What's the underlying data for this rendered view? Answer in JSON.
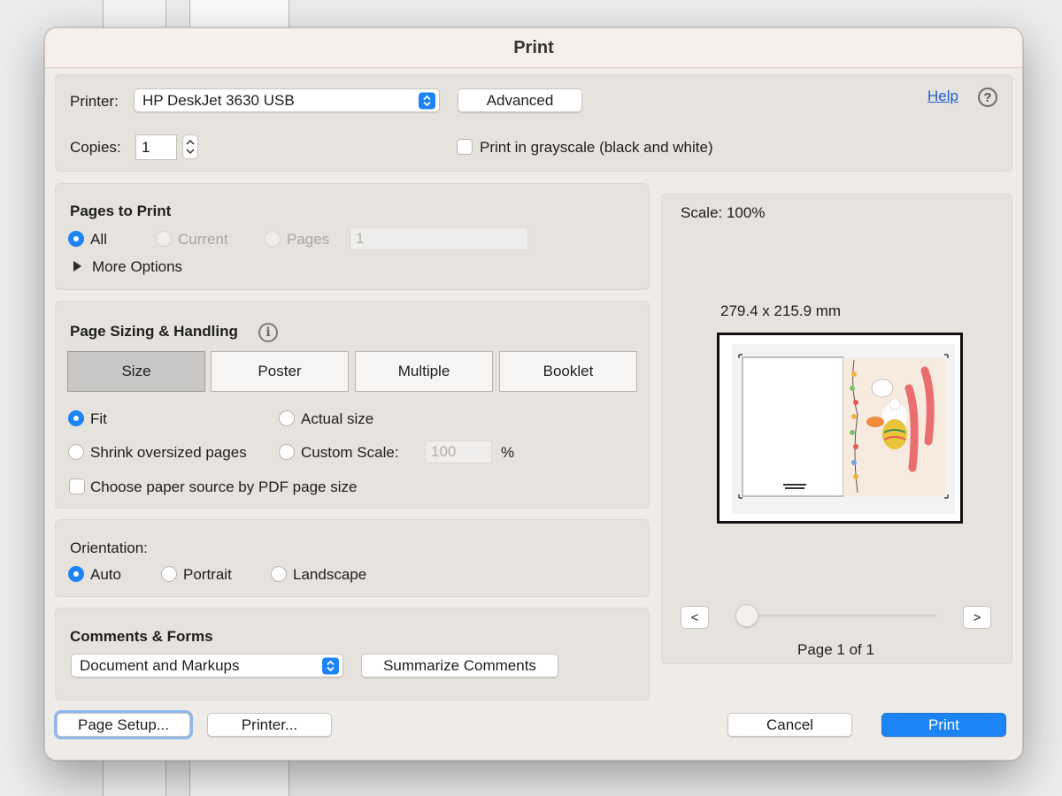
{
  "dialog": {
    "title": "Print"
  },
  "printer": {
    "label": "Printer:",
    "selected": "HP DeskJet 3630 USB",
    "advanced_label": "Advanced",
    "help_label": "Help",
    "help_icon": "question-circle-icon"
  },
  "copies": {
    "label": "Copies:",
    "value": "1"
  },
  "grayscale": {
    "label": "Print in grayscale (black and white)",
    "checked": false
  },
  "pages_to_print": {
    "title": "Pages to Print",
    "options": [
      "All",
      "Current",
      "Pages"
    ],
    "selected": "All",
    "pages_value": "1",
    "more_options_label": "More Options"
  },
  "sizing": {
    "title": "Page Sizing & Handling",
    "tabs": [
      "Size",
      "Poster",
      "Multiple",
      "Booklet"
    ],
    "active_tab": "Size",
    "fit_label": "Fit",
    "actual_size_label": "Actual size",
    "shrink_label": "Shrink oversized pages",
    "custom_scale_label": "Custom Scale:",
    "custom_scale_value": "100",
    "percent_sign": "%",
    "selected": "Fit",
    "paper_source_label": "Choose paper source by PDF page size"
  },
  "orientation": {
    "label": "Orientation:",
    "options": [
      "Auto",
      "Portrait",
      "Landscape"
    ],
    "selected": "Auto"
  },
  "comments_forms": {
    "title": "Comments & Forms",
    "selected": "Document and Markups",
    "summarize_label": "Summarize Comments"
  },
  "preview": {
    "scale_label": "Scale: 100%",
    "dimensions": "279.4 x 215.9 mm",
    "prev_label": "<",
    "next_label": ">",
    "page_indicator": "Page 1 of 1",
    "page_position": 0
  },
  "footer": {
    "page_setup_label": "Page Setup...",
    "printer_label": "Printer...",
    "cancel_label": "Cancel",
    "print_label": "Print"
  },
  "colors": {
    "accent": "#1d84f5",
    "dialog_bg": "#efebe7",
    "panel_bg": "#e6e2de",
    "link": "#1f5fd1"
  }
}
